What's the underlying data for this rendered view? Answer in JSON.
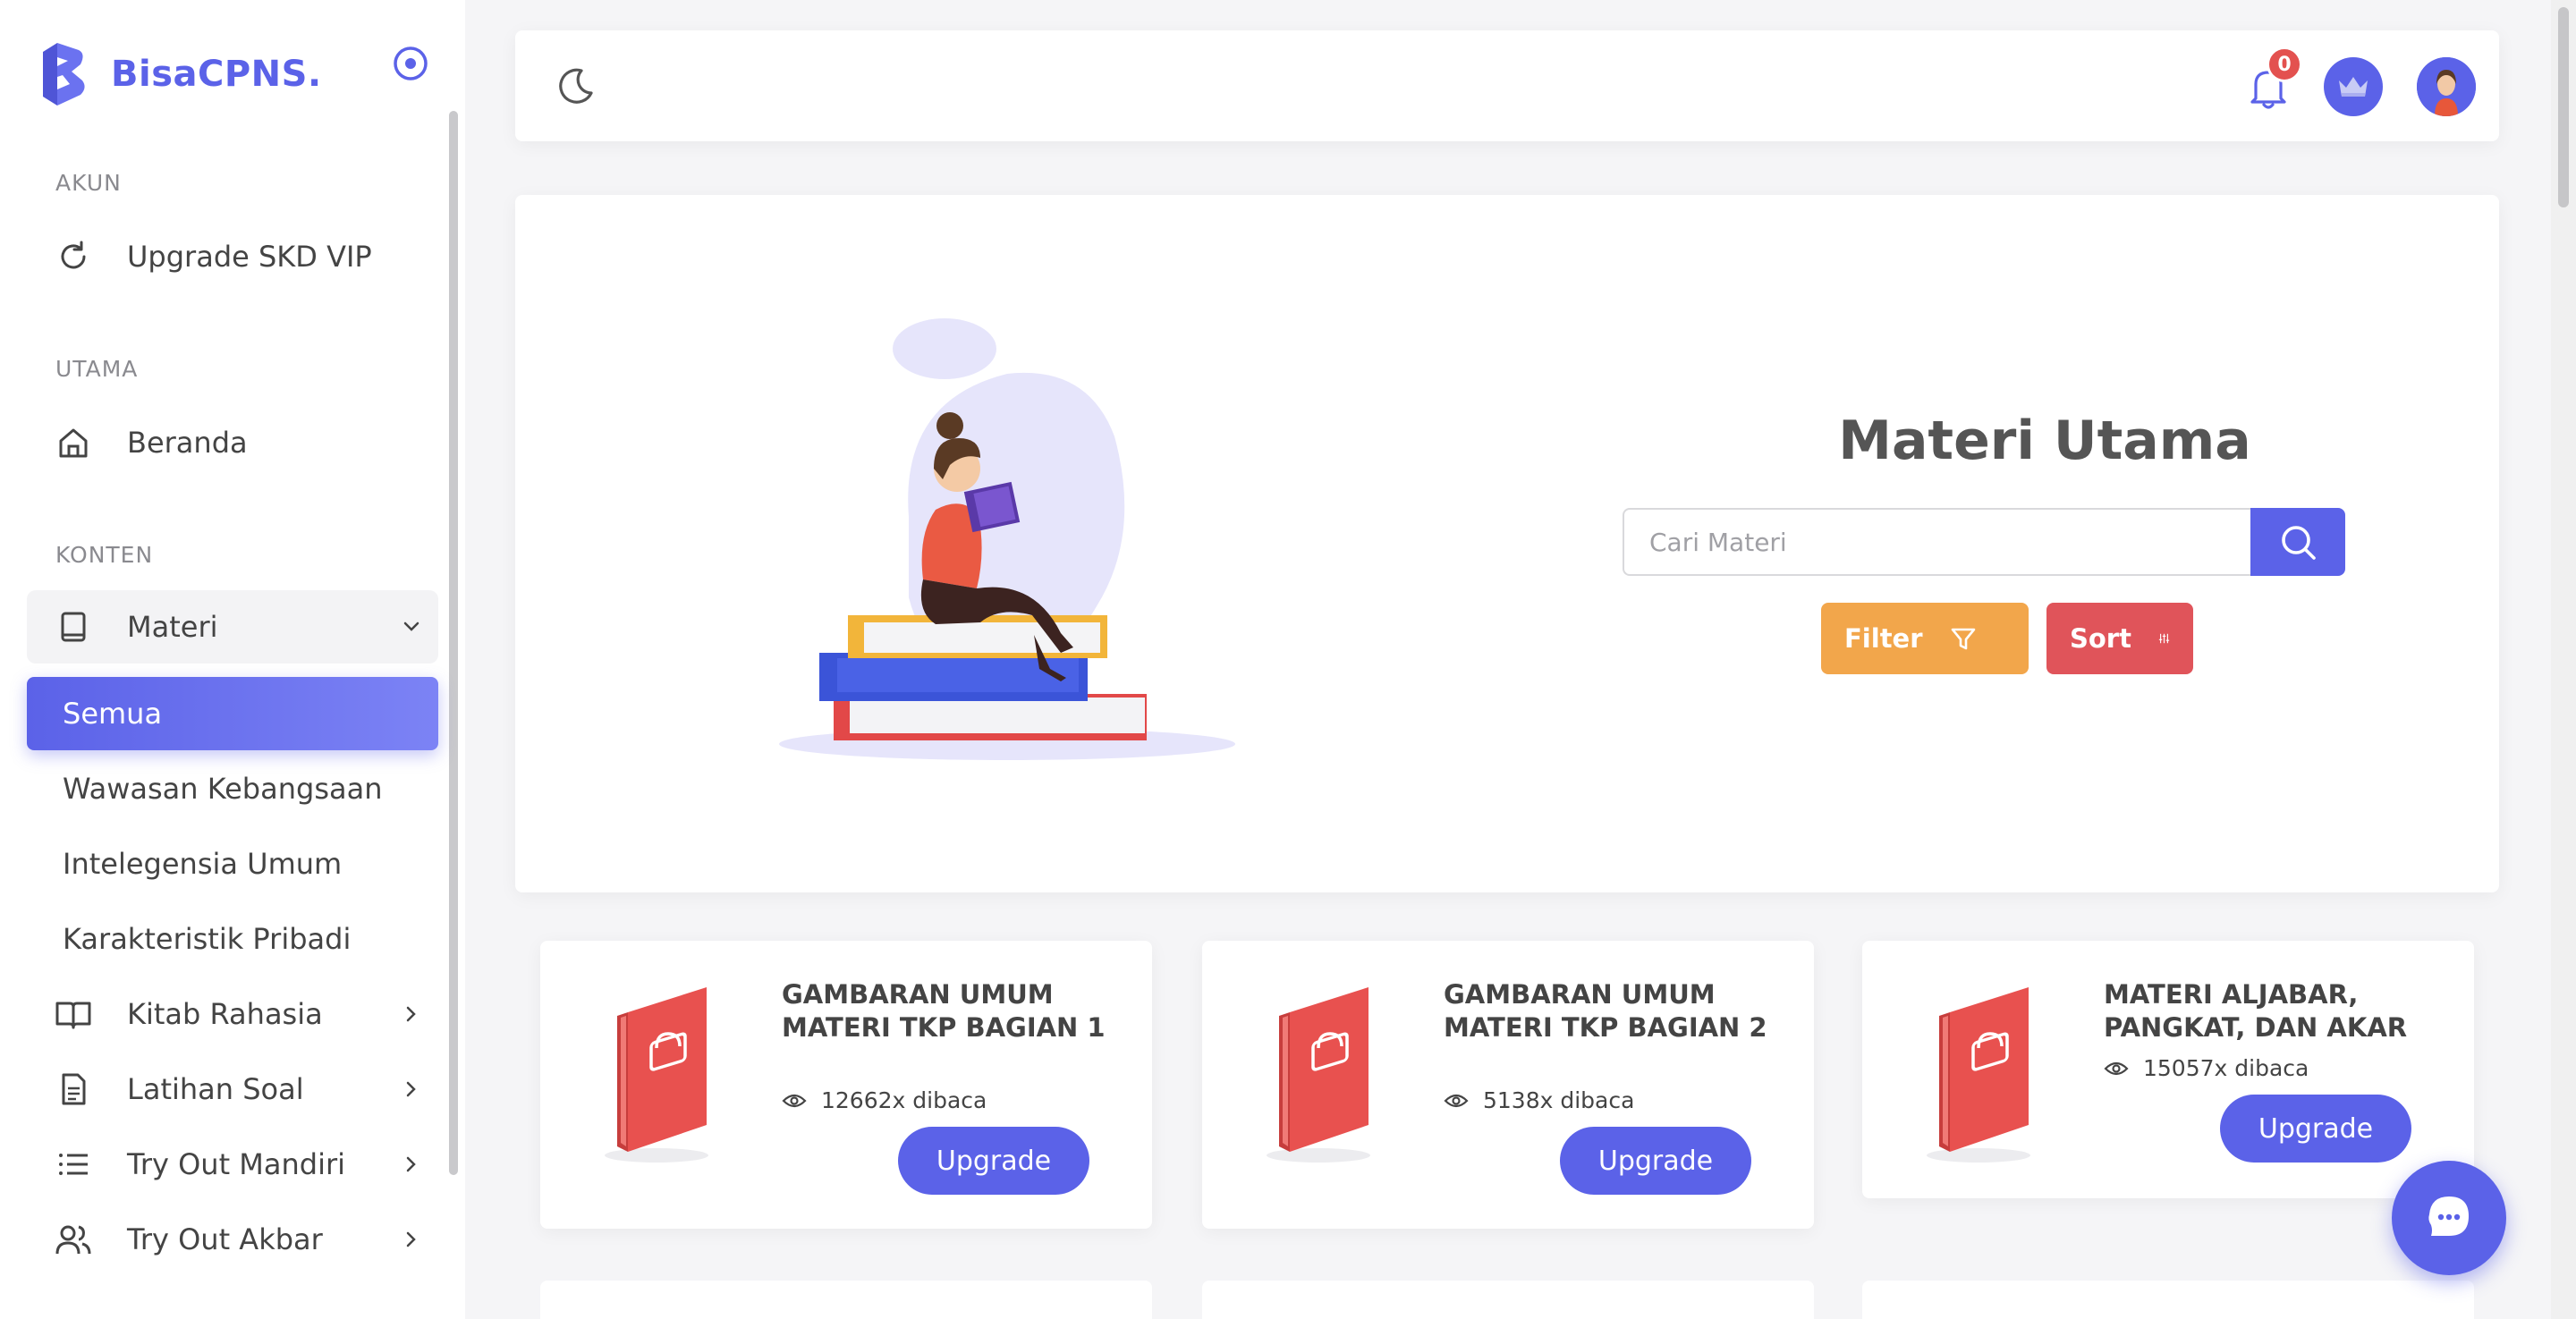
{
  "brand": {
    "name": "BisaCPNS."
  },
  "sidebar": {
    "sections": {
      "akun": "AKUN",
      "utama": "UTAMA",
      "konten": "KONTEN"
    },
    "items": {
      "upgrade": "Upgrade SKD VIP",
      "beranda": "Beranda",
      "materi": "Materi",
      "kitab": "Kitab Rahasia",
      "latihan": "Latihan Soal",
      "tryout_mandiri": "Try Out Mandiri",
      "tryout_akbar": "Try Out Akbar"
    },
    "submenu": [
      "Semua",
      "Wawasan Kebangsaan",
      "Intelegensia Umum",
      "Karakteristik Pribadi"
    ]
  },
  "topbar": {
    "notification_count": "0"
  },
  "hero": {
    "title": "Materi Utama",
    "search_placeholder": "Cari Materi",
    "filter_label": "Filter",
    "sort_label": "Sort"
  },
  "cards": [
    {
      "title": "GAMBARAN UMUM MATERI TKP BAGIAN 1",
      "views": "12662x dibaca",
      "button": "Upgrade"
    },
    {
      "title": "GAMBARAN UMUM MATERI TKP BAGIAN 2",
      "views": "5138x dibaca",
      "button": "Upgrade"
    },
    {
      "title": "MATERI ALJABAR, PANGKAT, DAN AKAR",
      "views": "15057x dibaca",
      "button": "Upgrade"
    }
  ],
  "colors": {
    "primary": "#5b62e8",
    "filter": "#f2a64b",
    "sort": "#e0545a",
    "badge": "#e3514f",
    "book": "#e8514f"
  }
}
